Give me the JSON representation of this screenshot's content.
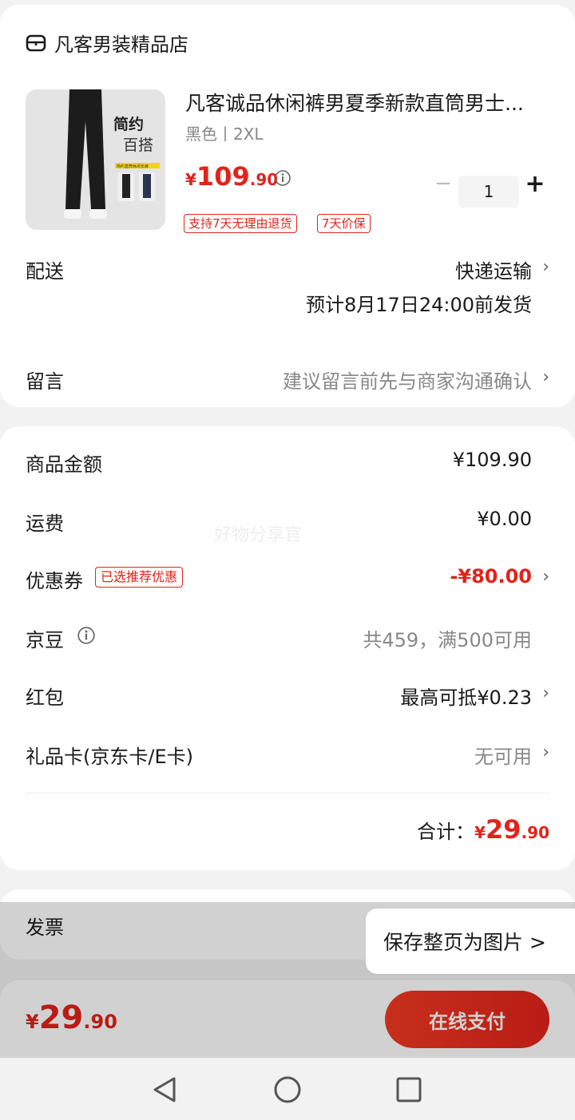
{
  "store": {
    "name": "凡客男装精品店",
    "product": {
      "title": "凡客诚品休闲裤男夏季新款直筒男士...",
      "spec": "黑色丨2XL",
      "price_symbol": "¥",
      "price_int": "109",
      "price_dec": ".90",
      "quantity": "1",
      "minus": "−",
      "plus": "+",
      "tags": [
        "支持7天无理由退货",
        "7天价保"
      ],
      "image_text": {
        "line1": "简约",
        "line2": "百搭",
        "banner": "简约直筒休闲长裤"
      }
    },
    "delivery": {
      "label": "配送",
      "method": "快递运输",
      "eta": "预计8月17日24:00前发货"
    },
    "message": {
      "label": "留言",
      "placeholder": "建议留言前先与商家沟通确认"
    }
  },
  "summary": {
    "goods_amount": {
      "label": "商品金额",
      "value": "¥109.90"
    },
    "shipping": {
      "label": "运费",
      "value": "¥0.00"
    },
    "coupon": {
      "label": "优惠券",
      "tag": "已选推荐优惠",
      "value": "-¥80.00"
    },
    "jingdou": {
      "label": "京豆",
      "value": "共459，满500可用"
    },
    "red_packet": {
      "label": "红包",
      "value": "最高可抵¥0.23"
    },
    "gift_card": {
      "label": "礼品卡(京东卡/E卡)",
      "value": "无可用"
    },
    "total": {
      "label": "合计：",
      "symbol": "¥",
      "int": "29",
      "dec": ".90"
    },
    "watermark": "好物分享官"
  },
  "invoice": {
    "label": "发票"
  },
  "save_popup": {
    "label": "保存整页为图片 >"
  },
  "bottom_bar": {
    "price_symbol": "¥",
    "price_int": "29",
    "price_dec": ".90",
    "pay_label": "在线支付"
  },
  "chevron": "›",
  "colors": {
    "accent": "#e2231a",
    "background": "#f2f2f2"
  }
}
